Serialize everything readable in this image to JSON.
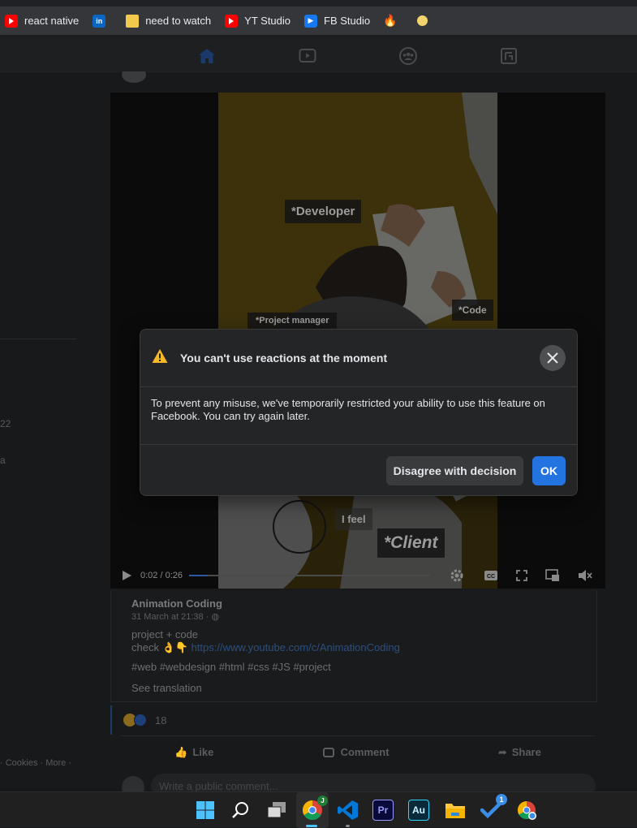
{
  "bookmarks": [
    {
      "label": "react native",
      "icon": "youtube-icon"
    },
    {
      "label": "",
      "icon": "linkedin-icon"
    },
    {
      "label": "need to watch",
      "icon": "folder-icon"
    },
    {
      "label": "YT Studio",
      "icon": "youtube-icon"
    },
    {
      "label": "FB Studio",
      "icon": "fb-studio-icon"
    },
    {
      "label": "",
      "icon": "tinder-icon"
    },
    {
      "label": "",
      "icon": "emoji-icon"
    }
  ],
  "sidebar": {
    "fragment_1": "22",
    "fragment_2": "a",
    "footer": "· Cookies · More ·"
  },
  "video": {
    "labels": {
      "developer": "*Developer",
      "project_manager": "*Project manager",
      "code": "*Code",
      "i_feel": "I feel",
      "client": "*Client"
    },
    "time": "0:02 / 0:26",
    "progress": 0.077
  },
  "post": {
    "author": "Animation Coding",
    "meta": "31 March at 21:38 ·",
    "line1": "project + code",
    "line2_prefix": "check 👌👇",
    "link": "https://www.youtube.com/c/AnimationCoding",
    "hashtags": "#web  #webdesign #html  #css #JS  #project",
    "see_translation": "See translation",
    "reaction_count": "18",
    "actions": {
      "like": "Like",
      "comment": "Comment",
      "share": "Share"
    },
    "comment_placeholder": "Write a public comment..."
  },
  "modal": {
    "title": "You can't use reactions at the moment",
    "body": "To prevent any misuse, we've temporarily restricted your ability to use this feature on Facebook. You can try again later.",
    "disagree_label": "Disagree with decision",
    "ok_label": "OK"
  },
  "taskbar": {
    "chrome_badge": "J",
    "premiere_label": "Pr",
    "audition_label": "Au",
    "todo_badge": "1"
  },
  "colors": {
    "primary": "#2374e1",
    "modal_bg": "#242526",
    "warning": "#f7b928"
  }
}
